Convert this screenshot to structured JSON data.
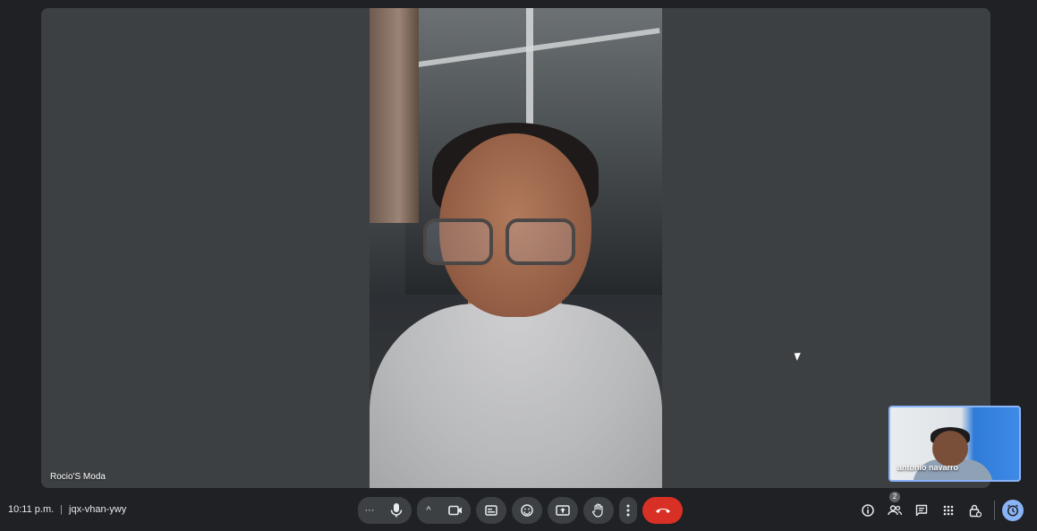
{
  "meeting": {
    "time": "10:11 p.m.",
    "separator": "|",
    "code": "jqx-vhan-ywy"
  },
  "main_tile": {
    "participant_name": "Rocio'S Moda"
  },
  "self_view": {
    "participant_name": "antonio navarro"
  },
  "controls": {
    "more_options_glyph": "···",
    "expand_glyph": "^",
    "icons": [
      "more-horiz-icon",
      "microphone-icon",
      "chevron-up-icon",
      "camera-icon",
      "captions-icon",
      "emoji-icon",
      "present-icon",
      "raise-hand-icon",
      "more-vert-icon",
      "hang-up-icon"
    ]
  },
  "right_tools": {
    "people_count": "2",
    "icons": [
      "info-icon",
      "people-icon",
      "chat-icon",
      "activities-icon",
      "host-controls-icon",
      "timer-icon"
    ]
  },
  "colors": {
    "background": "#202124",
    "tile": "#3c4043",
    "leave_red": "#d93025",
    "accent_blue": "#8ab4f8"
  }
}
